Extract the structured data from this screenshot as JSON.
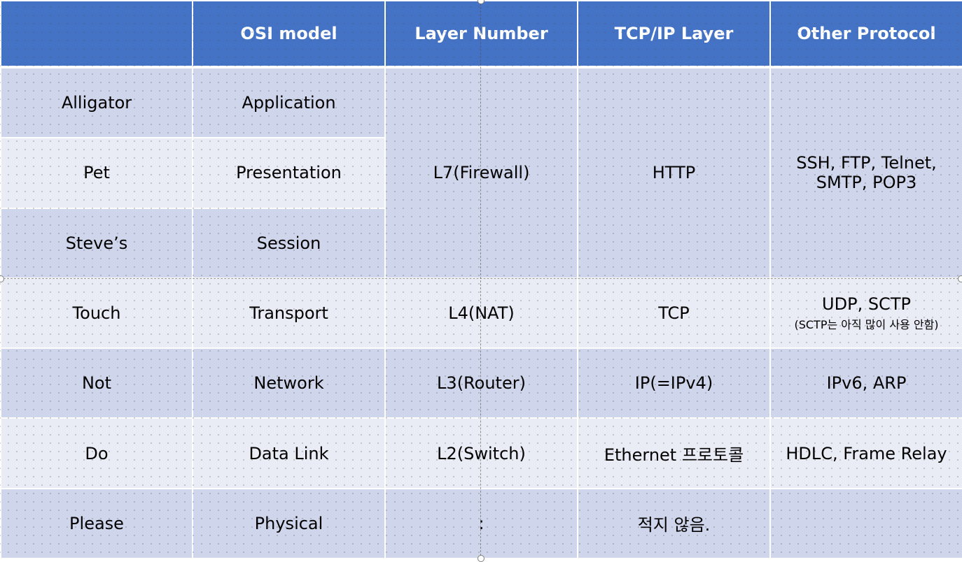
{
  "headers": [
    "",
    "OSI model",
    "Layer Number",
    "TCP/IP Layer",
    "Other Protocol"
  ],
  "rows": [
    {
      "mnemonic": "Alligator",
      "osi": "Application"
    },
    {
      "mnemonic": "Pet",
      "osi": "Presentation"
    },
    {
      "mnemonic": "Steve’s",
      "osi": "Session"
    },
    {
      "mnemonic": "Touch",
      "osi": "Transport"
    },
    {
      "mnemonic": "Not",
      "osi": "Network"
    },
    {
      "mnemonic": "Do",
      "osi": "Data Link"
    },
    {
      "mnemonic": "Please",
      "osi": "Physical"
    }
  ],
  "merged_upper": {
    "layer": "L7(Firewall)",
    "tcp": "HTTP",
    "other": "SSH, FTP, Telnet, SMTP, POP3"
  },
  "transport": {
    "layer": "L4(NAT)",
    "tcp": "TCP",
    "other": "UDP, SCTP",
    "other_note": "(SCTP는 아직 많이 사용 안함)"
  },
  "network": {
    "layer": "L3(Router)",
    "tcp": "IP(=IPv4)",
    "other": "IPv6, ARP"
  },
  "datalink": {
    "layer": "L2(Switch)",
    "tcp": "Ethernet 프로토콜",
    "other": "HDLC, Frame Relay"
  },
  "physical": {
    "layer": ":",
    "tcp": "적지 않음.",
    "other": ""
  },
  "colors": {
    "header_bg": "#4472c4",
    "row_dark": "#cfd5ea",
    "row_light": "#e9ebf5",
    "mnemonic_text": "#ff0000",
    "tcp_text": "#00b050"
  }
}
